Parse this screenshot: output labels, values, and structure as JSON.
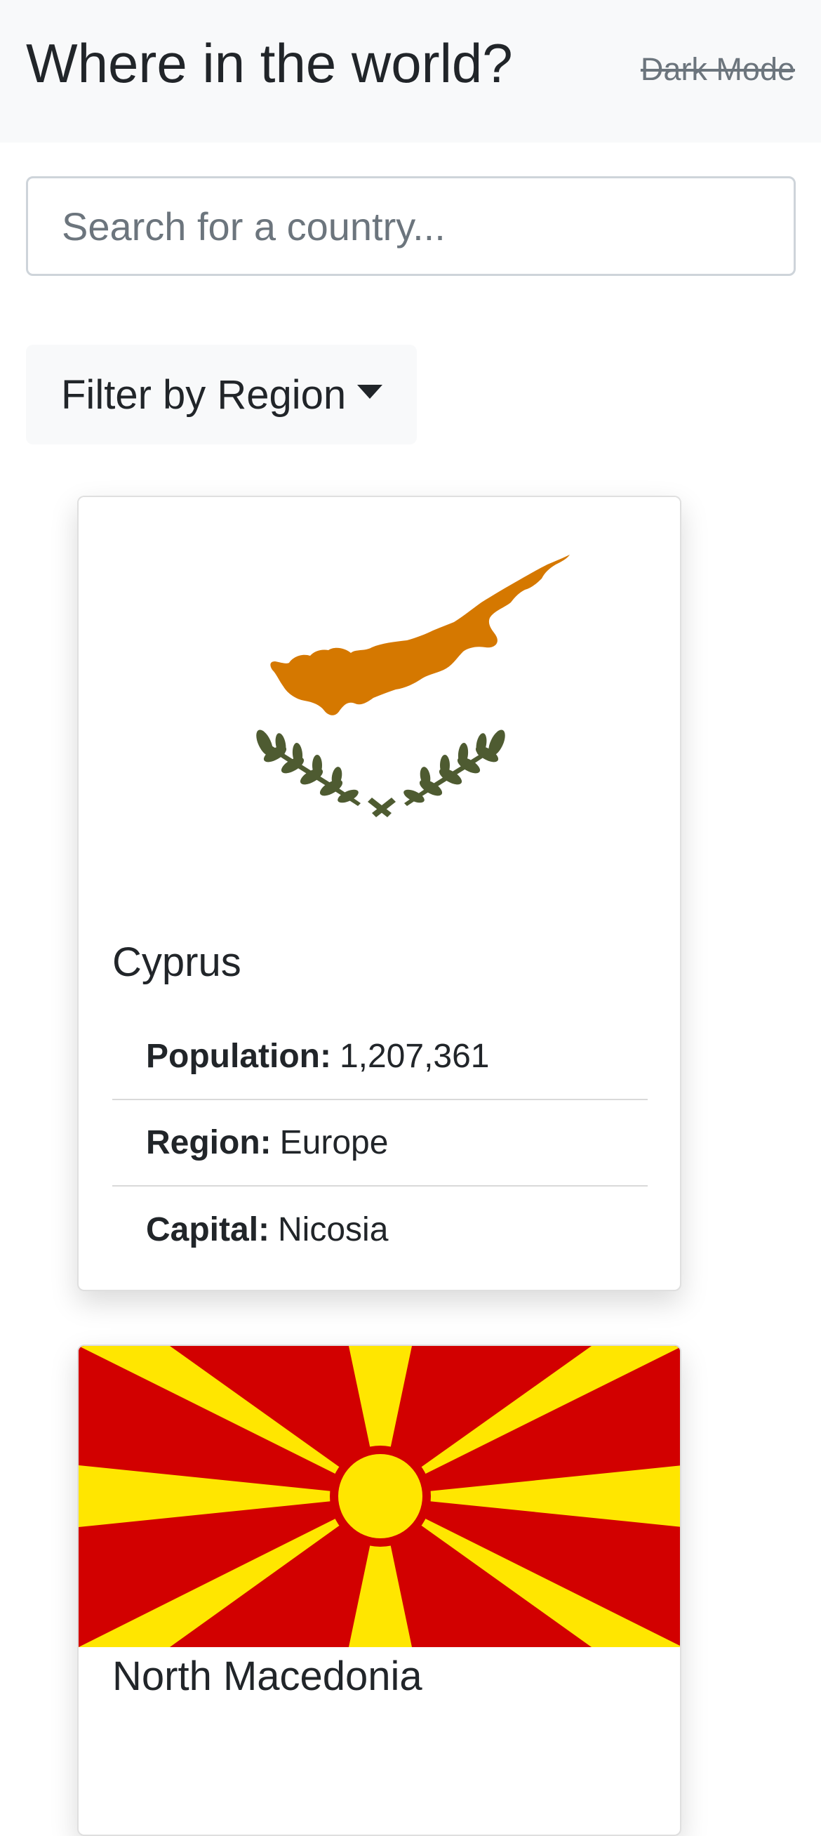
{
  "header": {
    "title": "Where in the world?",
    "dark_mode_label": "Dark Mode"
  },
  "search": {
    "placeholder": "Search for a country..."
  },
  "filter": {
    "label": "Filter by Region"
  },
  "countries": [
    {
      "name": "Cyprus",
      "population_label": "Population:",
      "population": "1,207,361",
      "region_label": "Region:",
      "region": "Europe",
      "capital_label": "Capital:",
      "capital": "Nicosia",
      "flag_icon": "cyprus-flag"
    },
    {
      "name": "North Macedonia",
      "flag_icon": "north-macedonia-flag"
    }
  ],
  "colors": {
    "cyprus_copper": "#d57800",
    "cyprus_olive": "#4e5b31",
    "macedonia_red": "#d20000",
    "macedonia_yellow": "#ffe600"
  }
}
